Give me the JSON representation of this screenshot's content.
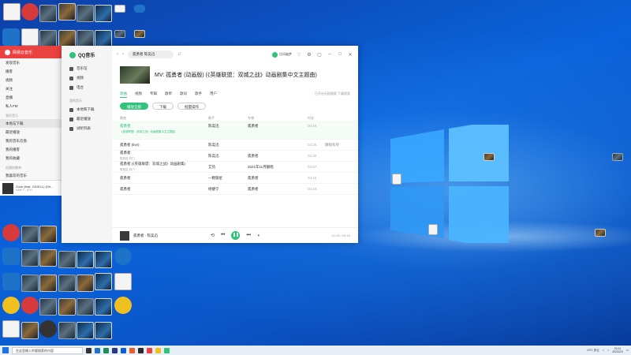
{
  "qq_music": {
    "brand": "QQ音乐",
    "search_value": "孤勇者 陈奕迅",
    "user_name": "坊间幽梦",
    "sidebar": {
      "items": [
        {
          "label": "音乐馆"
        },
        {
          "label": "视频"
        },
        {
          "label": "电台"
        }
      ],
      "group_label": "我的音乐",
      "my_items": [
        {
          "label": "本地和下载"
        },
        {
          "label": "最近播放"
        },
        {
          "label": "试听列表"
        }
      ]
    },
    "mv_title": "MV: 孤勇者 (动画版) (《英雄联盟：双城之战》动画剧集中文主题曲)",
    "tabs": [
      "歌曲",
      "视频",
      "专辑",
      "歌单",
      "歌词",
      "歌手",
      "用户"
    ],
    "tabs_right": "已开启无损搜索  下载搜索",
    "play_all_label": "播放全部",
    "download_label": "下载",
    "batch_label": "批量操作",
    "headers": [
      "歌曲",
      "歌手",
      "专辑",
      "时长"
    ],
    "rows": [
      {
        "title": "孤勇者",
        "sub": "《英雄联盟：双城之战》动画剧集中文主题曲",
        "artist": "陈奕迅",
        "album": "孤勇者",
        "duration": "04:16",
        "highlight": true
      },
      {
        "title": "孤勇者 (live)",
        "sub": "",
        "artist": "陈奕迅",
        "album": "",
        "duration": "04:25",
        "extra": "跟唱有奖",
        "highlight": false
      },
      {
        "title": "孤勇者",
        "sub": "陈奕迅 热门",
        "artist": "陈奕迅",
        "album": "孤勇者",
        "duration": "04:20",
        "highlight": false
      },
      {
        "title": "孤勇者 (《英雄联盟：双城之战》动画剧集)",
        "sub": "陈奕迅 热门",
        "artist": "艾热",
        "album": "2021年11月翻唱",
        "duration": "04:27",
        "highlight": false
      },
      {
        "title": "孤勇者",
        "sub": "",
        "artist": "一颗狼星",
        "album": "孤勇者",
        "duration": "04:15",
        "highlight": false
      },
      {
        "title": "孤勇者",
        "sub": "",
        "artist": "杨健宁",
        "album": "孤勇者",
        "duration": "04:18",
        "highlight": false
      }
    ],
    "player": {
      "song": "孤勇者 - 陈奕迅",
      "time": "01:03 / 04:16",
      "play_glyph": "❚❚"
    }
  },
  "netease": {
    "title": "网易云音乐",
    "items": [
      {
        "label": "发现音乐"
      },
      {
        "label": "播客"
      },
      {
        "label": "视频"
      },
      {
        "label": "关注"
      },
      {
        "label": "直播"
      },
      {
        "label": "私人FM"
      }
    ],
    "group_label": "我的音乐",
    "my_items": [
      {
        "label": "本地与下载"
      },
      {
        "label": "最近播放"
      },
      {
        "label": "我的音乐云盘"
      },
      {
        "label": "我的播客"
      },
      {
        "label": "我的收藏"
      }
    ],
    "group2_label": "创建的歌单",
    "playlist": {
      "label": "我喜欢的音乐"
    },
    "now_playing": "Zone (feat. JVDELL) (Ori...",
    "now_artist": "HAM F - A7H"
  },
  "taskbar": {
    "search_placeholder": "在这里输入你要搜索的内容",
    "weather": "10°C 多云",
    "time": "20:11",
    "date": "2023/2/3"
  },
  "colors": {
    "qq_green": "#31c27c",
    "netease_red": "#ec4141",
    "desktop_blue": "#0a63dc"
  }
}
